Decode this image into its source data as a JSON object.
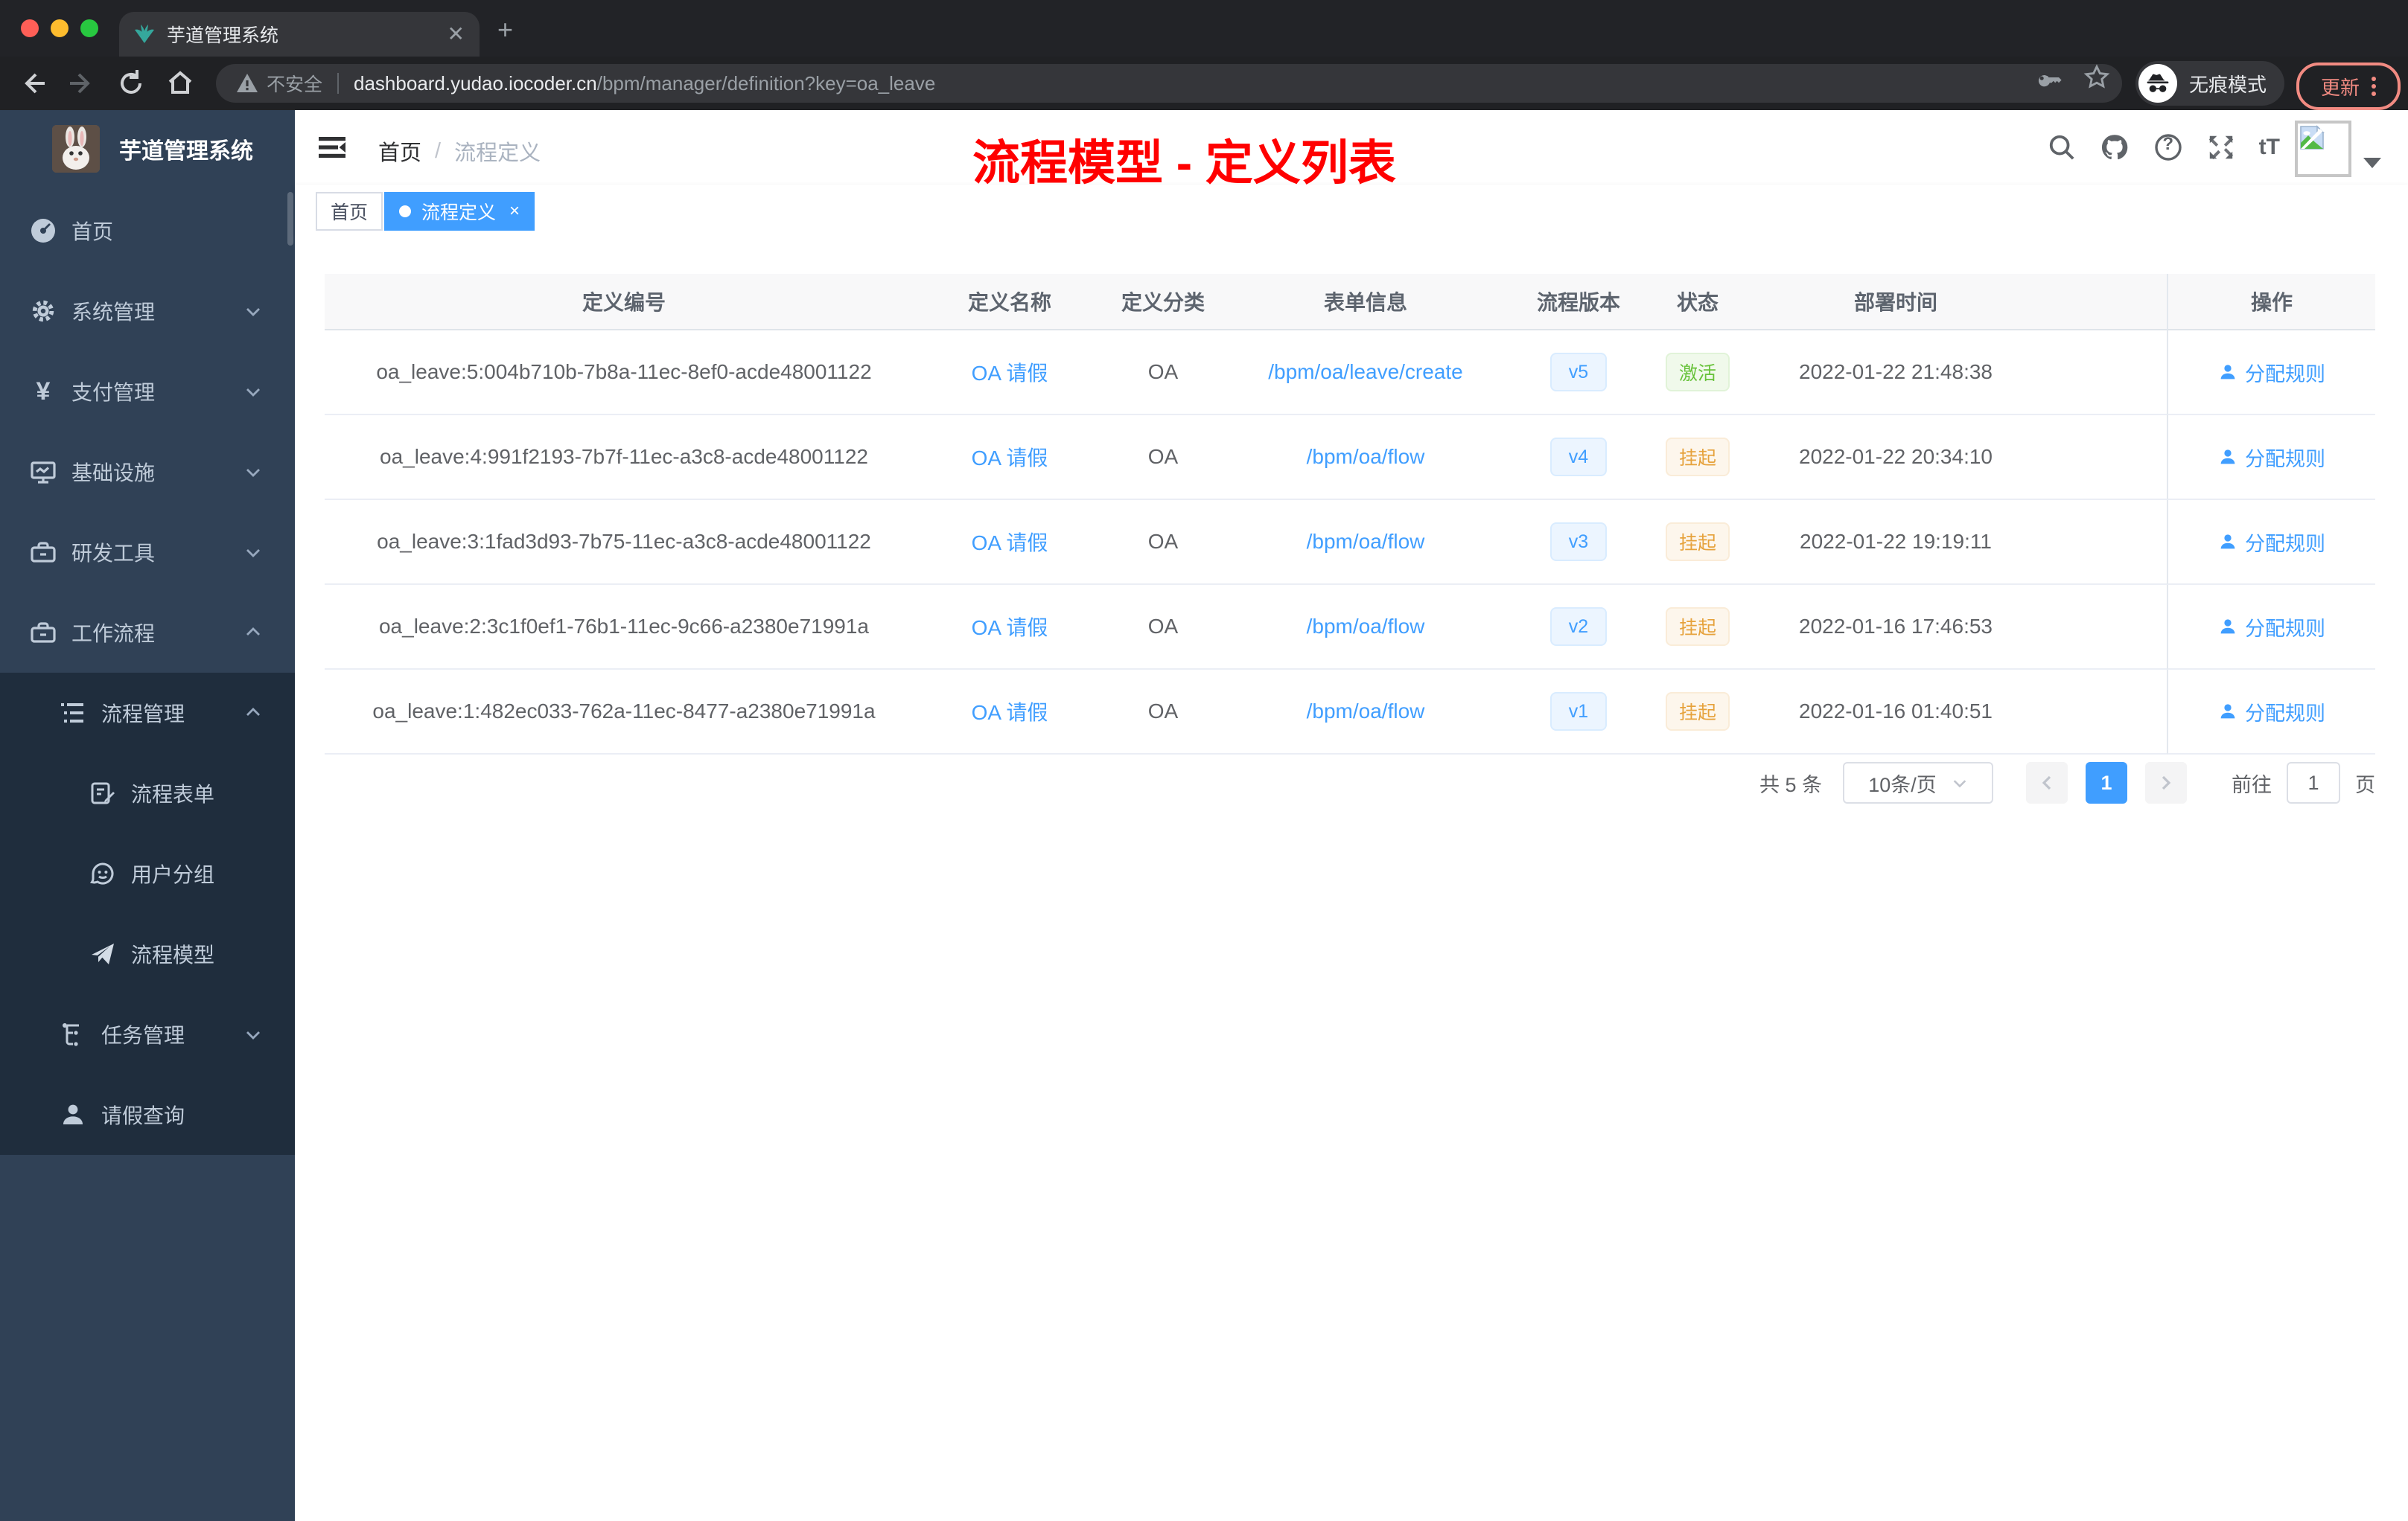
{
  "browser": {
    "tab_title": "芋道管理系统",
    "new_tab_label": "+",
    "close_tab_label": "✕",
    "security_label": "不安全",
    "url_domain": "dashboard.yudao.iocoder.cn",
    "url_path": "/bpm/manager/definition?key=oa_leave",
    "incognito_label": "无痕模式",
    "update_label": "更新"
  },
  "sidebar": {
    "title": "芋道管理系统",
    "items": [
      {
        "label": "首页",
        "icon": "dashboard-icon"
      },
      {
        "label": "系统管理",
        "icon": "gear-icon",
        "arrow": "down"
      },
      {
        "label": "支付管理",
        "icon": "yen-icon",
        "arrow": "down"
      },
      {
        "label": "基础设施",
        "icon": "monitor-icon",
        "arrow": "down"
      },
      {
        "label": "研发工具",
        "icon": "toolbox-icon",
        "arrow": "down"
      },
      {
        "label": "工作流程",
        "icon": "toolbox-icon",
        "arrow": "up"
      },
      {
        "label": "流程管理",
        "icon": "list-tree-icon",
        "arrow": "up"
      },
      {
        "label": "流程表单",
        "icon": "form-icon"
      },
      {
        "label": "用户分组",
        "icon": "face-icon"
      },
      {
        "label": "流程模型",
        "icon": "paper-plane-icon"
      },
      {
        "label": "任务管理",
        "icon": "tree-icon",
        "arrow": "down"
      },
      {
        "label": "请假查询",
        "icon": "user-icon"
      }
    ],
    "yen_glyph": "¥"
  },
  "header": {
    "breadcrumb_home": "首页",
    "breadcrumb_separator": "/",
    "breadcrumb_current": "流程定义",
    "annotation": "流程模型 - 定义列表",
    "help_glyph": "?",
    "fontsize_glyph": "tT"
  },
  "tags": {
    "first": "首页",
    "active": "流程定义",
    "close_glyph": "×"
  },
  "table": {
    "columns": [
      "定义编号",
      "定义名称",
      "定义分类",
      "表单信息",
      "流程版本",
      "状态",
      "部署时间",
      "操作"
    ],
    "rows": [
      {
        "id": "oa_leave:5:004b710b-7b8a-11ec-8ef0-acde48001122",
        "name": "OA 请假",
        "category": "OA",
        "form": "/bpm/oa/leave/create",
        "version": "v5",
        "status": "激活",
        "status_class": "success",
        "deploy_time": "2022-01-22 21:48:38",
        "action": "分配规则"
      },
      {
        "id": "oa_leave:4:991f2193-7b7f-11ec-a3c8-acde48001122",
        "name": "OA 请假",
        "category": "OA",
        "form": "/bpm/oa/flow",
        "version": "v4",
        "status": "挂起",
        "status_class": "warning",
        "deploy_time": "2022-01-22 20:34:10",
        "action": "分配规则"
      },
      {
        "id": "oa_leave:3:1fad3d93-7b75-11ec-a3c8-acde48001122",
        "name": "OA 请假",
        "category": "OA",
        "form": "/bpm/oa/flow",
        "version": "v3",
        "status": "挂起",
        "status_class": "warning",
        "deploy_time": "2022-01-22 19:19:11",
        "action": "分配规则"
      },
      {
        "id": "oa_leave:2:3c1f0ef1-76b1-11ec-9c66-a2380e71991a",
        "name": "OA 请假",
        "category": "OA",
        "form": "/bpm/oa/flow",
        "version": "v2",
        "status": "挂起",
        "status_class": "warning",
        "deploy_time": "2022-01-16 17:46:53",
        "action": "分配规则"
      },
      {
        "id": "oa_leave:1:482ec033-762a-11ec-8477-a2380e71991a",
        "name": "OA 请假",
        "category": "OA",
        "form": "/bpm/oa/flow",
        "version": "v1",
        "status": "挂起",
        "status_class": "warning",
        "deploy_time": "2022-01-16 01:40:51",
        "action": "分配规则"
      }
    ]
  },
  "pagination": {
    "total": "共 5 条",
    "page_size": "10条/页",
    "current_page": "1",
    "goto_label": "前往",
    "goto_value": "1",
    "page_unit": "页"
  },
  "colors": {
    "accent_blue": "#409eff",
    "success_green": "#67c23a",
    "warning_orange": "#e6a23c",
    "annotation_red": "#ff0000",
    "sidebar_bg": "#304156",
    "sidebar_submenu_bg": "#1f2d3d",
    "sidebar_text": "#bfcbd9",
    "chrome_update_red": "#f28b82",
    "table_header_bg": "#f8f8f9"
  }
}
